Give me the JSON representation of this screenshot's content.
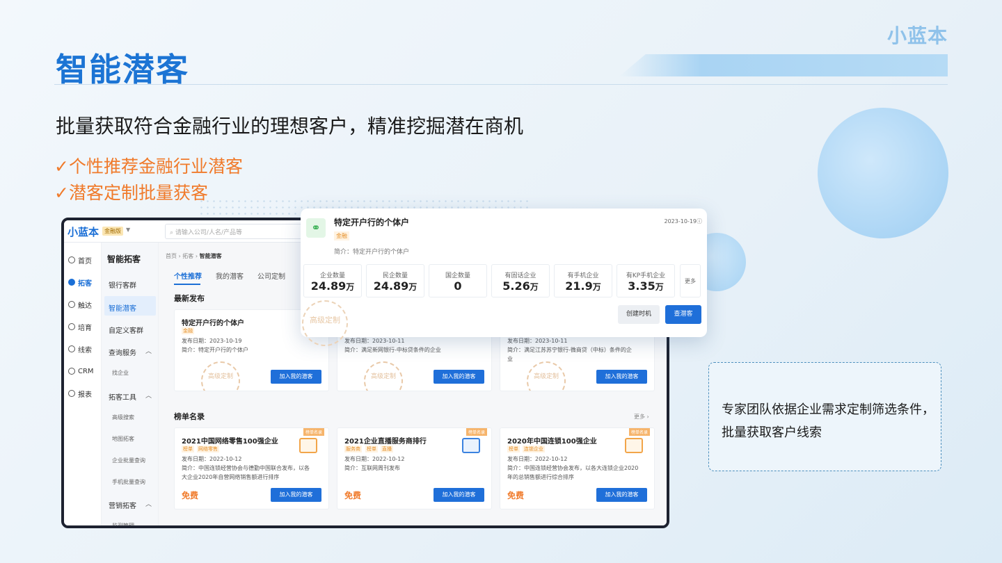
{
  "slide": {
    "brand": "小蓝本",
    "title": "智能潜客",
    "subtitle": "批量获取符合金融行业的理想客户，精准挖掘潜在商机",
    "checks": [
      "✓个性推荐金融行业潜客",
      "✓潜客定制批量获客"
    ],
    "note_lines": [
      "专家团队依据企业需求定制筛选条件，",
      "批量获取客户线索"
    ]
  },
  "app": {
    "logo": "小蓝本",
    "edition": "金融版",
    "search_placeholder": "请输入公司/人名/产品等",
    "nav": [
      {
        "label": "首页",
        "icon": "home-icon"
      },
      {
        "label": "拓客",
        "icon": "compass-icon"
      },
      {
        "label": "触达",
        "icon": "target-icon"
      },
      {
        "label": "培育",
        "icon": "sprout-icon"
      },
      {
        "label": "线索",
        "icon": "clue-icon"
      },
      {
        "label": "CRM",
        "icon": "crm-icon"
      },
      {
        "label": "报表",
        "icon": "chart-icon"
      }
    ],
    "sub_heading": "智能拓客",
    "sub_items": [
      "银行客群",
      "智能潜客",
      "自定义客群",
      "查询服务",
      "找企业",
      "拓客工具",
      "高级搜索",
      "地图拓客",
      "企业批量查询",
      "手机批量查询",
      "营销拓客",
      "监测管理"
    ],
    "breadcrumb": [
      "首页",
      "拓客",
      "智能潜客"
    ],
    "tabs": [
      "个性推荐",
      "我的潜客",
      "公司定制"
    ],
    "section_latest": "最新发布",
    "section_rank": "榜单名录",
    "more": "更多",
    "latest_cards": [
      {
        "title": "特定开户行的个体户",
        "tag": "金融",
        "date": "发布日期：2023-10-19",
        "intro": "简介：特定开户行的个体户",
        "button": "加入我的潜客",
        "seal": "高级定制"
      },
      {
        "date": "发布日期：2023-10-11",
        "intro": "简介：满足新网银行-中标贷条件的企业",
        "button": "加入我的潜客",
        "seal": "高级定制"
      },
      {
        "date": "发布日期：2023-10-11",
        "intro": "简介：满足江苏苏宁银行-微商贷（中标）条件的企",
        "intro2": "业",
        "button": "加入我的潜客",
        "seal": "高级定制"
      }
    ],
    "rank_cards": [
      {
        "title": "2021中国网络零售100强企业",
        "tags": [
          "榜单",
          "网络零售"
        ],
        "badge": "榜单名录",
        "date": "发布日期：2022-10-12",
        "intro": "简介：中国连锁经营协会与德勤中国联合发布，以各",
        "intro2": "大企业2020年自营网络销售额进行排序",
        "price": "免费",
        "button": "加入我的潜客"
      },
      {
        "title": "2021企业直播服务商排行",
        "tags": [
          "服务商",
          "榜单",
          "直播"
        ],
        "badge": "榜单名录",
        "date": "发布日期：2022-10-12",
        "intro": "简介：互联网周刊发布",
        "intro2": "",
        "price": "免费",
        "button": "加入我的潜客"
      },
      {
        "title": "2020年中国连锁100强企业",
        "tags": [
          "榜单",
          "连锁企业"
        ],
        "badge": "榜单名录",
        "date": "发布日期：2022-10-12",
        "intro": "简介：中国连锁经营协会发布，以各大连锁企业2020",
        "intro2": "年的总销售额进行综合排序",
        "price": "免费",
        "button": "加入我的潜客"
      }
    ]
  },
  "popup": {
    "title": "特定开户行的个体户",
    "tag": "金融",
    "date": "2023-10-19",
    "intro": "简介：特定开户行的个体户",
    "stats": [
      {
        "label": "企业数量",
        "value": "24.89",
        "unit": "万"
      },
      {
        "label": "民企数量",
        "value": "24.89",
        "unit": "万"
      },
      {
        "label": "国企数量",
        "value": "0",
        "unit": ""
      },
      {
        "label": "有固话企业",
        "value": "5.26",
        "unit": "万"
      },
      {
        "label": "有手机企业",
        "value": "21.9",
        "unit": "万"
      },
      {
        "label": "有KP手机企业",
        "value": "3.35",
        "unit": "万"
      }
    ],
    "stats_more": "更多",
    "btn_create": "创建时机",
    "btn_view": "查潜客",
    "seal": "高级定制"
  },
  "colors": {
    "accent": "#1c74d4",
    "orange": "#f07a2a",
    "button": "#1f6fd9"
  }
}
